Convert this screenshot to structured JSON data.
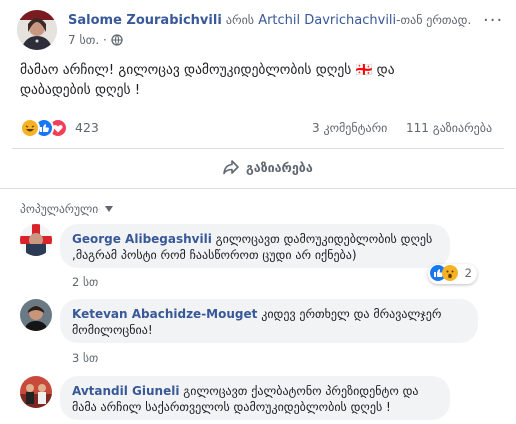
{
  "post": {
    "author": "Salome Zourabichvili",
    "with_prefix": "არის",
    "tagged": "Artchil Davrichachvili",
    "with_suffix": "-თან ერთად.",
    "time": "7 სთ.",
    "text_line1": "მამაო არჩილ! გილოცავ დამოუკიდებლობის დღეს 🇬🇪 და",
    "text_line2": "დაბადების დღეს !",
    "reaction_count": "423",
    "comments_count": "3 კომენტარი",
    "shares_count": "111 გაზიარება",
    "share_label": "გაზიარება"
  },
  "comments_section": {
    "sort_label": "პოპულარული"
  },
  "comments": [
    {
      "author": "George Alibegashvili",
      "line1": "გილოცავთ დამოუკიდებლობის დღეს",
      "line2": ",მაგრამ პოსტი რომ ჩაასწოროთ ცუდი არ იქნება)",
      "time": "2 სთ",
      "reactions": "2"
    },
    {
      "author": "Ketevan Abachidze-Mouget",
      "line1": "კიდევ ერთხელ და მრავალჯერ",
      "line2": "მომილოცნია!",
      "time": "3 სთ"
    },
    {
      "author": "Avtandil Giuneli",
      "line1": "გილოცავთ ქალბატონო პრეზიდენტო და",
      "line2": "მამა არჩილ საქართველოს დამოუკიდებლობის დღეს !"
    }
  ],
  "colors": {
    "link": "#385898",
    "like": "#1877f2",
    "love": "#f33e58",
    "haha": "#f7b125"
  }
}
